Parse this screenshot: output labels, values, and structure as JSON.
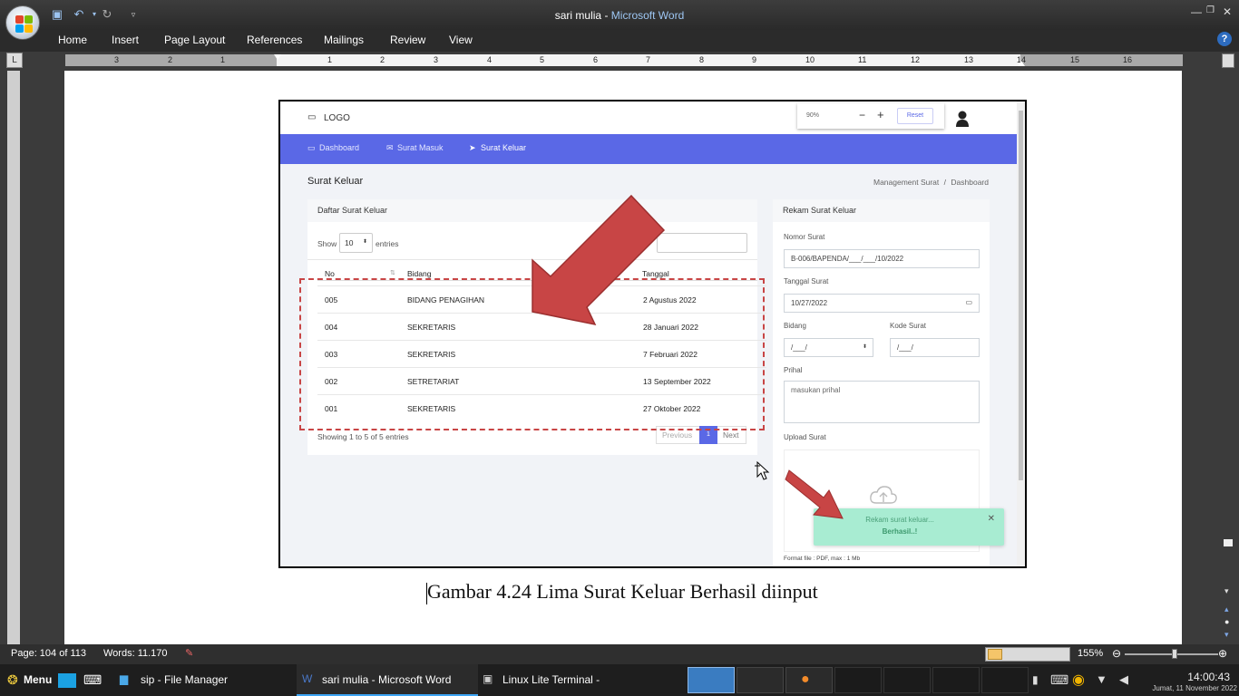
{
  "window": {
    "doc_name": "sari mulia",
    "sep": " - ",
    "app_name": "Microsoft Word"
  },
  "ribbon": {
    "tabs": [
      "Home",
      "Insert",
      "Page Layout",
      "References",
      "Mailings",
      "Review",
      "View"
    ]
  },
  "ruler": {
    "numbers": [
      "3",
      "2",
      "1",
      "1",
      "2",
      "3",
      "4",
      "5",
      "6",
      "7",
      "8",
      "9",
      "10",
      "11",
      "12",
      "13",
      "14",
      "15",
      "16"
    ]
  },
  "figure": {
    "app": {
      "logo": "LOGO",
      "zoom_value": "90%",
      "zoom_minus": "−",
      "zoom_plus": "+",
      "zoom_reset": "Reset",
      "menu": {
        "dashboard": "Dashboard",
        "surat_masuk": "Surat Masuk",
        "surat_keluar": "Surat Keluar"
      },
      "page_title": "Surat Keluar",
      "breadcrumb": {
        "parent": "Management Surat",
        "sep": "/",
        "current": "Dashboard"
      },
      "list": {
        "title": "Daftar Surat Keluar",
        "show_label": "Show",
        "entries_value": "10",
        "entries_label": "entries",
        "columns": {
          "no": "No",
          "bidang": "Bidang",
          "tanggal": "Tanggal"
        },
        "rows": [
          {
            "no": "005",
            "bidang": "BIDANG PENAGIHAN",
            "tanggal": "2 Agustus 2022"
          },
          {
            "no": "004",
            "bidang": "SEKRETARIS",
            "tanggal": "28 Januari 2022"
          },
          {
            "no": "003",
            "bidang": "SEKRETARIS",
            "tanggal": "7 Februari 2022"
          },
          {
            "no": "002",
            "bidang": "SETRETARIAT",
            "tanggal": "13 September 2022"
          },
          {
            "no": "001",
            "bidang": "SEKRETARIS",
            "tanggal": "27 Oktober 2022"
          }
        ],
        "info": "Showing 1 to 5 of 5 entries",
        "pagination": {
          "previous": "Previous",
          "page": "1",
          "next": "Next"
        }
      },
      "form": {
        "title": "Rekam Surat Keluar",
        "nomor_label": "Nomor Surat",
        "nomor_value": "B-006/BAPENDA/___/___/10/2022",
        "tanggal_label": "Tanggal Surat",
        "tanggal_value": "10/27/2022",
        "bidang_label": "Bidang",
        "bidang_value": "/___/",
        "kode_label": "Kode Surat",
        "kode_value": "/___/",
        "prihal_label": "Prihal",
        "prihal_placeholder": "masukan prihal",
        "upload_label": "Upload Surat",
        "format_note": "Format file : PDF, max : 1 Mb"
      },
      "toast": {
        "line1": "Rekam surat keluar...",
        "line2": "Berhasil..!",
        "close": "✕"
      }
    },
    "caption": "Gambar 4.24 Lima Surat Keluar Berhasil diinput"
  },
  "status": {
    "page": "Page: 104 of 113",
    "words": "Words: 11.170",
    "zoom": "155%"
  },
  "taskbar": {
    "menu": "Menu",
    "tasks": [
      "sip - File Manager",
      "sari mulia - Microsoft Word",
      "Linux Lite Terminal -"
    ],
    "time": "14:00:43",
    "date": "Jumat, 11 November 2022"
  },
  "colors": {
    "accent": "#5a68e6",
    "toast_bg": "#a8ecd2",
    "arrow": "#c84545"
  }
}
